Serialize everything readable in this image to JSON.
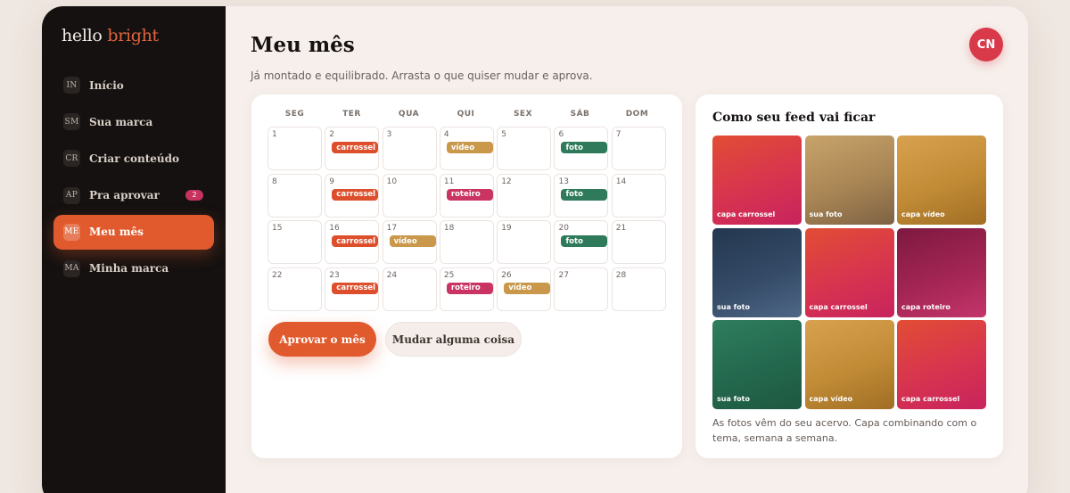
{
  "brand": {
    "logo_prefix": "hello",
    "logo_accent": "bright"
  },
  "sidebar": {
    "items": [
      {
        "abbr": "IN",
        "label": "Início",
        "active": false
      },
      {
        "abbr": "SM",
        "label": "Sua marca",
        "active": false
      },
      {
        "abbr": "CR",
        "label": "Criar conteúdo",
        "active": false
      },
      {
        "abbr": "AP",
        "label": "Pra aprovar",
        "active": false,
        "badge": "2"
      },
      {
        "abbr": "ME",
        "label": "Meu mês",
        "active": true
      },
      {
        "abbr": "MA",
        "label": "Minha marca",
        "active": false
      }
    ]
  },
  "header": {
    "title": "Meu mês",
    "subtitle": "Já montado e equilibrado. Arrasta o que quiser mudar e aprova.",
    "avatar_initials": "CN"
  },
  "calendar": {
    "weekdays": [
      "SEG",
      "TER",
      "QUA",
      "QUI",
      "SEX",
      "SÁB",
      "DOM"
    ],
    "days": [
      {
        "n": "1"
      },
      {
        "n": "2",
        "tag": "carrossel"
      },
      {
        "n": "3"
      },
      {
        "n": "4",
        "tag": "vídeo"
      },
      {
        "n": "5"
      },
      {
        "n": "6",
        "tag": "foto"
      },
      {
        "n": "7"
      },
      {
        "n": "8"
      },
      {
        "n": "9",
        "tag": "carrossel"
      },
      {
        "n": "10"
      },
      {
        "n": "11",
        "tag": "roteiro"
      },
      {
        "n": "12"
      },
      {
        "n": "13",
        "tag": "foto"
      },
      {
        "n": "14"
      },
      {
        "n": "15"
      },
      {
        "n": "16",
        "tag": "carrossel"
      },
      {
        "n": "17",
        "tag": "vídeo"
      },
      {
        "n": "18"
      },
      {
        "n": "19"
      },
      {
        "n": "20",
        "tag": "foto"
      },
      {
        "n": "21"
      },
      {
        "n": "22"
      },
      {
        "n": "23",
        "tag": "carrossel"
      },
      {
        "n": "24"
      },
      {
        "n": "25",
        "tag": "roteiro"
      },
      {
        "n": "26",
        "tag": "vídeo"
      },
      {
        "n": "27"
      },
      {
        "n": "28"
      }
    ],
    "tag_colors": {
      "carrossel": "#dd4f2c",
      "vídeo": "#c9984b",
      "foto": "#2f7a5a",
      "roteiro": "#c93462"
    },
    "approve_label": "Aprovar o mês",
    "change_label": "Mudar alguma coisa"
  },
  "feed": {
    "title": "Como seu feed vai ficar",
    "tiles": [
      {
        "label": "capa carrossel",
        "style": "red"
      },
      {
        "label": "sua foto",
        "style": "tan"
      },
      {
        "label": "capa vídeo",
        "style": "gold"
      },
      {
        "label": "sua foto",
        "style": "navy"
      },
      {
        "label": "capa carrossel",
        "style": "red"
      },
      {
        "label": "capa roteiro",
        "style": "plum"
      },
      {
        "label": "sua foto",
        "style": "green"
      },
      {
        "label": "capa vídeo",
        "style": "gold"
      },
      {
        "label": "capa carrossel",
        "style": "red"
      }
    ],
    "note": "As fotos vêm do seu acervo. Capa combinando com o tema, semana a semana."
  }
}
